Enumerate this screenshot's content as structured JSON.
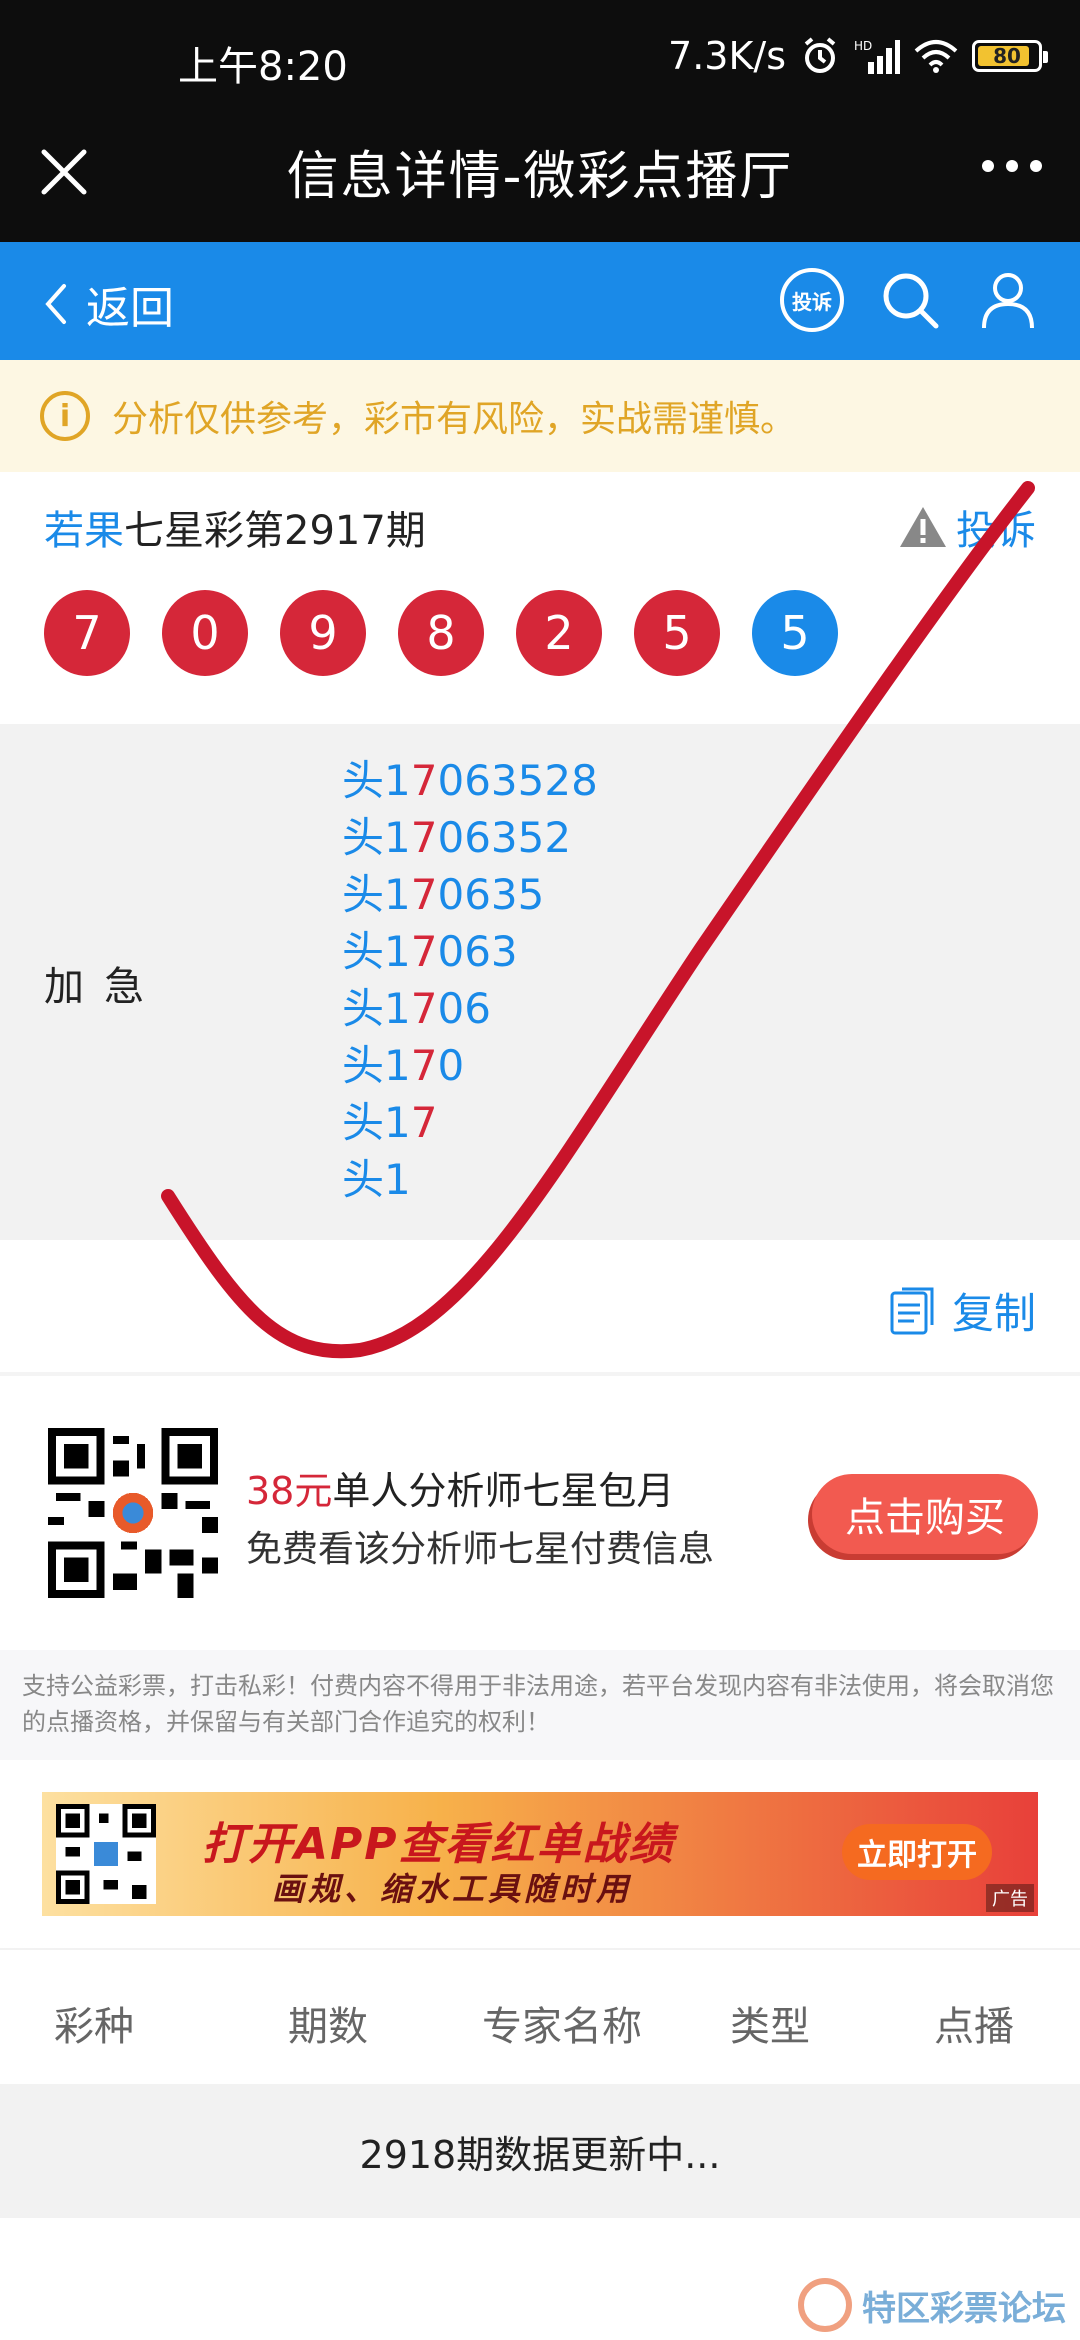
{
  "status_bar": {
    "time": "上午8:20",
    "speed": "7.3K/s",
    "battery": "80"
  },
  "title_bar": {
    "title": "信息详情-微彩点播厅"
  },
  "nav": {
    "back_label": "返回",
    "complain_label": "投诉"
  },
  "notice": {
    "text": "分析仅供参考，彩市有风险，实战需谨慎。"
  },
  "post": {
    "author": "若果",
    "issue_text": "七星彩第2917期",
    "report_label": "投诉",
    "balls": [
      "7",
      "0",
      "9",
      "8",
      "2",
      "5",
      "5"
    ],
    "label": "加急",
    "lines": [
      {
        "a": "头1",
        "b": "7",
        "c": "063528"
      },
      {
        "a": "头1",
        "b": "7",
        "c": "06352"
      },
      {
        "a": "头1",
        "b": "7",
        "c": "0635"
      },
      {
        "a": "头1",
        "b": "7",
        "c": "063"
      },
      {
        "a": "头1",
        "b": "7",
        "c": "06"
      },
      {
        "a": "头1",
        "b": "7",
        "c": "0"
      },
      {
        "a": "头1",
        "b": "7",
        "c": ""
      },
      {
        "a": "头1",
        "b": "",
        "c": ""
      }
    ],
    "copy_label": "复制"
  },
  "promo": {
    "price": "38元",
    "title": "单人分析师七星包月",
    "subtitle": "免费看该分析师七星付费信息",
    "buy_label": "点击购买"
  },
  "disclaimer": "支持公益彩票，打击私彩！付费内容不得用于非法用途，若平台发现内容有非法使用，将会取消您的点播资格，并保留与有关部门合作追究的权利！",
  "banner": {
    "headline": "打开APP查看红单战绩",
    "subline": "画规、缩水工具随时用",
    "button": "立即打开",
    "ad_tag": "广告"
  },
  "table": {
    "headers": [
      "彩种",
      "期数",
      "专家名称",
      "类型",
      "点播"
    ],
    "status": "2918期数据更新中..."
  },
  "watermark": {
    "text": "特区彩票论坛"
  },
  "colors": {
    "accent": "#1a8ae8",
    "red": "#d52739",
    "notice": "#e0a526"
  }
}
